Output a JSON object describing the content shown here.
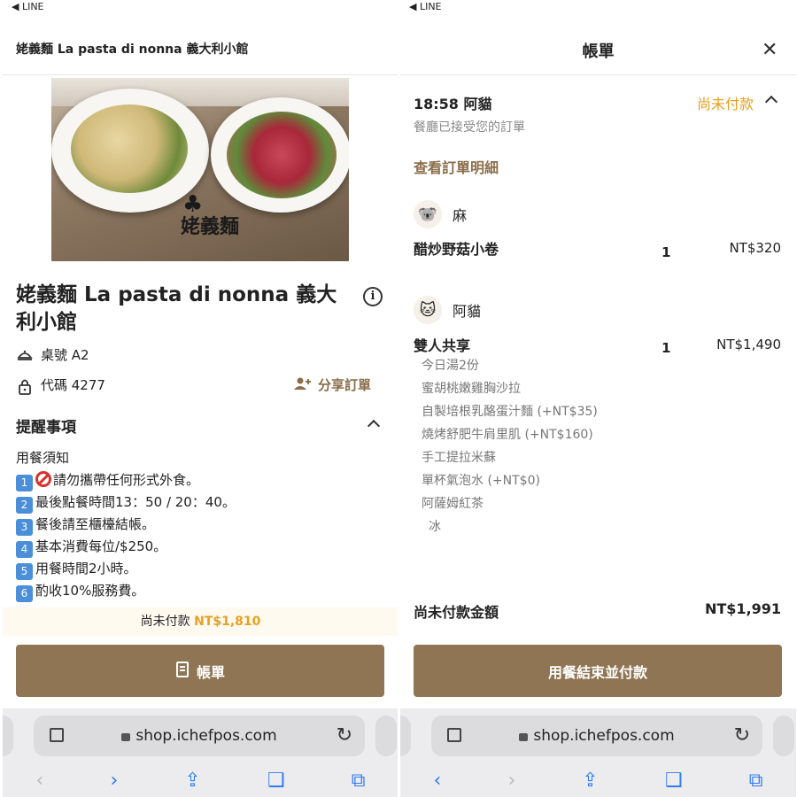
{
  "status_bar": {
    "back_label": "◀ LINE"
  },
  "left": {
    "header_title": "姥義麵 La pasta di nonna 義大利小館",
    "hero": {
      "logo_text": "姥義麵"
    },
    "restaurant_title": "姥義麵 La pasta di nonna 義大利小館",
    "table_label": "桌號 A2",
    "code_label": "代碼 4277",
    "share_label": "分享訂單",
    "reminder_title": "提醒事項",
    "notes_intro": "用餐須知",
    "notes": [
      {
        "num": "1",
        "text": "請勿攜帶任何形式外食。"
      },
      {
        "num": "2",
        "text": "最後點餐時間13：50 / 20：40。"
      },
      {
        "num": "3",
        "text": "餐後請至櫃檯結帳。"
      },
      {
        "num": "4",
        "text": "基本消費每位/$250。"
      },
      {
        "num": "5",
        "text": "用餐時間2小時。"
      },
      {
        "num": "6",
        "text": "酌收10%服務費。"
      }
    ],
    "unpaid_label": "尚未付款",
    "unpaid_amount": "NT$1,810",
    "bill_button": "帳單"
  },
  "right": {
    "header_title": "帳單",
    "order_time_name": "18:58 阿貓",
    "order_status": "尚未付款",
    "accepted_text": "餐廳已接受您的訂單",
    "detail_link": "查看訂單明細",
    "persons": [
      {
        "icon": "koala-icon",
        "name": "麻",
        "items": [
          {
            "name": "醋炒野菇小卷",
            "qty": "1",
            "price": "NT$320"
          }
        ]
      },
      {
        "icon": "cat-icon",
        "name": "阿貓",
        "items": [
          {
            "name": "雙人共享",
            "qty": "1",
            "price": "NT$1,490"
          }
        ],
        "sub_items": [
          "今日湯2份",
          "蜜胡桃嫩雞胸沙拉",
          "自製培根乳酪蛋汁麵 (+NT$35)",
          "燒烤舒肥牛肩里肌 (+NT$160)",
          "手工提拉米蘇",
          "單杯氣泡水 (+NT$0)",
          "阿薩姆紅茶",
          "冰"
        ]
      }
    ],
    "total_label": "尚未付款金額",
    "total_amount": "NT$1,991",
    "pay_button": "用餐結束並付款"
  },
  "browser": {
    "url": "shop.ichefpos.com"
  },
  "colors": {
    "accent": "#8f7553",
    "unpaid": "#e8a020",
    "link": "#8b6d4a",
    "safari_blue": "#2f7cf6"
  }
}
